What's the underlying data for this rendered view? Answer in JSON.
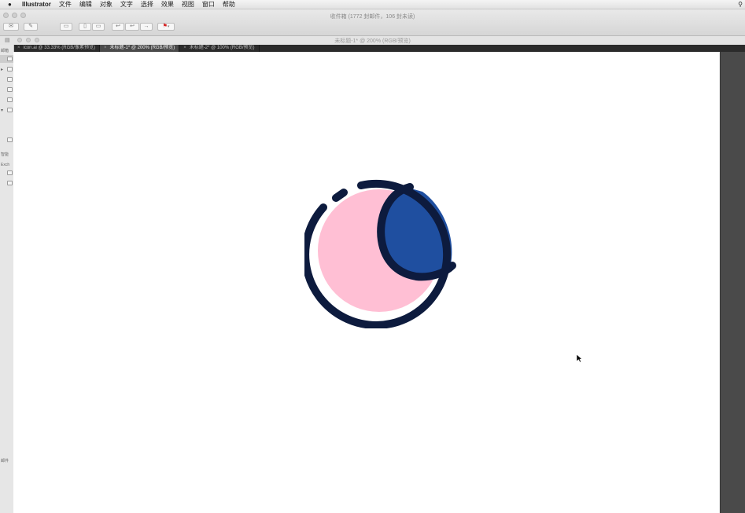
{
  "menubar": {
    "apple": "",
    "app": "Illustrator",
    "items": [
      "文件",
      "编辑",
      "对象",
      "文字",
      "选择",
      "效果",
      "视图",
      "窗口",
      "帮助"
    ]
  },
  "mail_window": {
    "title": "收件箱 (1772 封邮件，106 封未读)"
  },
  "document_window": {
    "title": "未标题-1* @ 200% (RGB/预览)"
  },
  "tabs": [
    {
      "label": "icon.ai @ 33.33% (RGB/像素预览)",
      "active": false
    },
    {
      "label": "未标题-1* @ 200% (RGB/预览)",
      "active": true
    },
    {
      "label": "未标题-2* @ 100% (RGB/预览)",
      "active": false
    }
  ],
  "sidebar": {
    "header": "邮箱",
    "smart": "智能",
    "exch": "Exch",
    "footer": "邮件"
  },
  "artwork": {
    "outline": "#0d1b3e",
    "pink": "#ffbfd4",
    "blue": "#1f4fa0"
  },
  "colors": {
    "canvas": "#ffffff",
    "pasteboard": "#4a4a4a"
  }
}
